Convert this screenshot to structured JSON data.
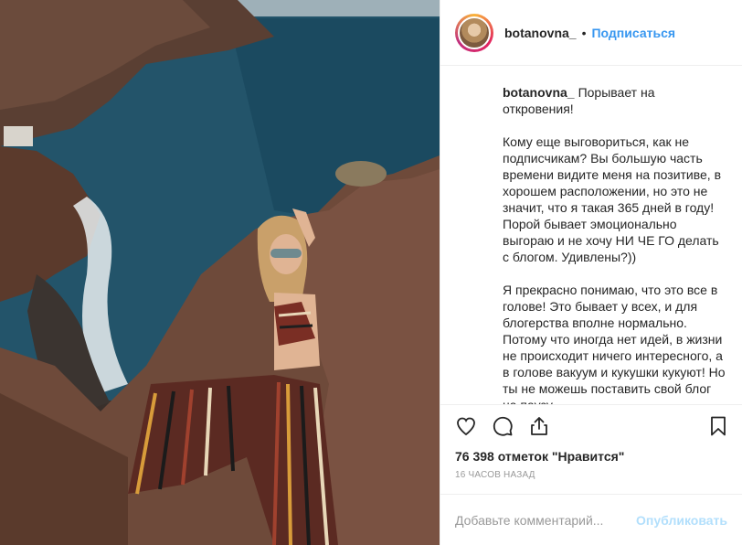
{
  "post": {
    "username": "botanovna_",
    "follow_label": "Подписаться",
    "dot": "•",
    "caption_user": "botanovna_",
    "caption_paragraphs": [
      "Порывает на откровения!",
      "Кому еще выговориться, как не подписчикам? Вы большую часть времени видите меня на позитиве, в хорошем расположении, но это не значит, что я такая 365 дней в году! Порой бывает эмоционально выгораю и не хочу НИ ЧЕ ГО делать с блогом. Удивлены?))",
      "Я прекрасно понимаю, что это все в голове! Это бывает у всех, и для блогерства вполне нормально. Потому что иногда нет идей, в жизни не происходит ничего интересного, а в голове вакуум и кукушки кукуют! Но ты не можешь поставить свой блог на паузу"
    ],
    "likes": "76 398 отметок \"Нравится\"",
    "time": "16 часов назад",
    "comment_placeholder": "Добавьте комментарий...",
    "publish_label": "Опубликовать"
  },
  "icons": [
    "heart-icon",
    "comment-icon",
    "share-icon",
    "bookmark-icon"
  ]
}
